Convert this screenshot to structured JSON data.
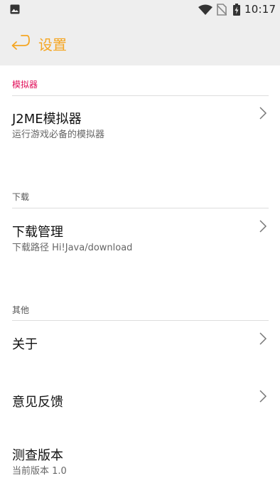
{
  "status_bar": {
    "time": "10:17",
    "icons": [
      "photo-icon",
      "wifi-icon",
      "no-sim-icon",
      "battery-icon"
    ]
  },
  "app_bar": {
    "title": "设置",
    "back_icon": "back-arrow-icon",
    "accent_color": "#f5a623"
  },
  "sections": [
    {
      "header": "模拟器",
      "header_color": "#e0105a",
      "items": [
        {
          "title": "J2ME模拟器",
          "subtitle": "运行游戏必备的模拟器",
          "chevron": true
        }
      ]
    },
    {
      "header": "下载",
      "header_color": "#555555",
      "items": [
        {
          "title": "下载管理",
          "subtitle": "下载路径 Hi!Java/download",
          "chevron": true
        }
      ]
    },
    {
      "header": "其他",
      "header_color": "#555555",
      "items": [
        {
          "title": "关于",
          "chevron": true
        },
        {
          "title": "意见反馈",
          "chevron": true
        },
        {
          "title": "测查版本",
          "subtitle": "当前版本 1.0",
          "chevron": false
        }
      ]
    }
  ]
}
